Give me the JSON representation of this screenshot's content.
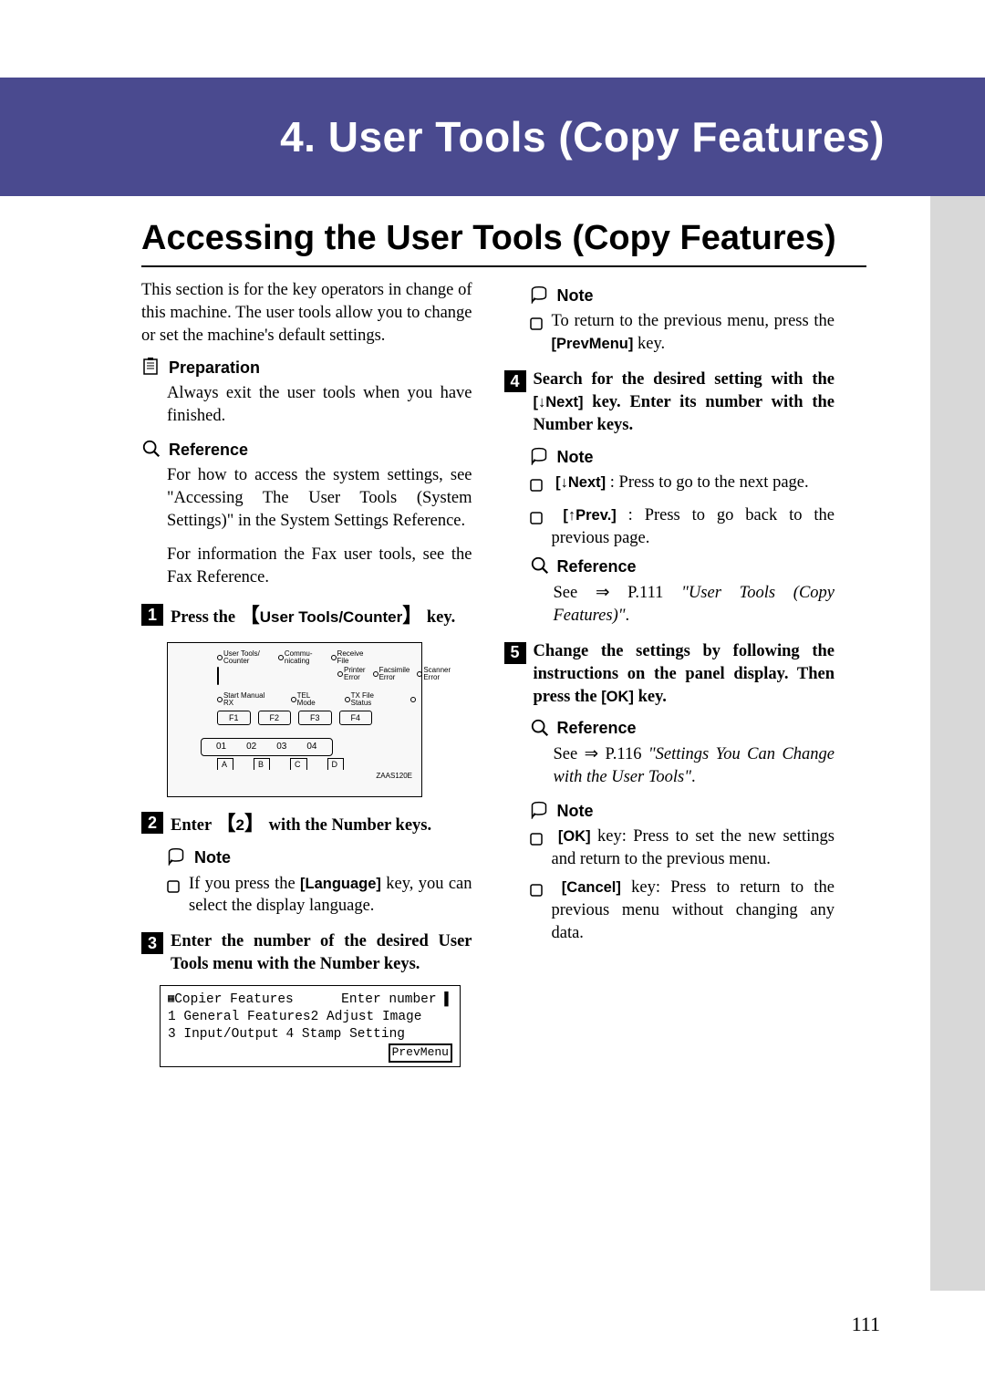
{
  "chapter": "4. User Tools (Copy Features)",
  "section": "Accessing the User Tools (Copy Features)",
  "intro": "This section is for the key operators in change of this machine. The user tools allow you to change or set the machine's default settings.",
  "preparation": {
    "heading": "Preparation",
    "body": "Always exit the user tools when you have finished."
  },
  "reference1": {
    "heading": "Reference",
    "body1": "For how to access the system settings, see \"Accessing The User Tools (System Settings)\" in the System Settings Reference.",
    "body2": "For information the Fax user tools, see the Fax Reference."
  },
  "step1": {
    "prefix": "Press the ",
    "key": "User Tools/Counter",
    "suffix": " key."
  },
  "diagram": {
    "indicators": {
      "usertools": "User Tools/\nCounter",
      "commu": "Commu-\nnicating",
      "receive": "Receive\nFile",
      "printer": "Printer\nError",
      "fax": "Facsimile\nError",
      "scanner": "Scanner\nError"
    },
    "status": {
      "start": "Start Manual RX",
      "tel": "TEL Mode",
      "tx": "TX File Status"
    },
    "fkeys": [
      "F1",
      "F2",
      "F3",
      "F4"
    ],
    "nums": [
      "01",
      "02",
      "03",
      "04"
    ],
    "letters": [
      "A",
      "B",
      "C",
      "D"
    ],
    "code": "ZAAS120E"
  },
  "step2": {
    "prefix": "Enter ",
    "key": "2",
    "suffix": " with the Number keys."
  },
  "note2": {
    "heading": "Note",
    "body_prefix": "If you press the ",
    "key": "[Language]",
    "body_suffix": " key, you can select the display language."
  },
  "step3": "Enter the number of the desired User Tools menu with the Number keys.",
  "lcd": {
    "title": "Copier Features",
    "prompt": "Enter number",
    "item1": "1 General Features",
    "item2": "2 Adjust Image",
    "item3": "3 Input/Output",
    "item4": "4 Stamp Setting",
    "prevmenu": "PrevMenu"
  },
  "note3": {
    "heading": "Note",
    "body_prefix": "To return to the previous menu, press the ",
    "key": "[PrevMenu]",
    "body_suffix": " key."
  },
  "step4": {
    "prefix": "Search for the desired setting with the ",
    "key": "[↓Next]",
    "suffix": " key. Enter its number with the Number keys."
  },
  "note4": {
    "heading": "Note",
    "next_key": "[↓Next]",
    "next_body": " : Press to go to the next page.",
    "prev_key": "[↑Prev.]",
    "prev_body": " : Press to go back to the previous page."
  },
  "reference4": {
    "heading": "Reference",
    "body_prefix": "See ⇒ P.111 ",
    "italic": "\"User Tools (Copy Features)\"",
    "body_suffix": "."
  },
  "step5": {
    "prefix": "Change the settings by following the instructions on the panel display. Then press the ",
    "key": "[OK]",
    "suffix": " key."
  },
  "reference5": {
    "heading": "Reference",
    "body_prefix": "See ⇒ P.116 ",
    "italic": "\"Settings You Can Change with the User Tools\"",
    "body_suffix": "."
  },
  "note5": {
    "heading": "Note",
    "ok_key": "[OK]",
    "ok_body": " key: Press to set the new settings and return to the previous menu.",
    "cancel_key": "[Cancel]",
    "cancel_body": " key: Press to return to the previous menu without changing any data."
  },
  "page_number": "111"
}
